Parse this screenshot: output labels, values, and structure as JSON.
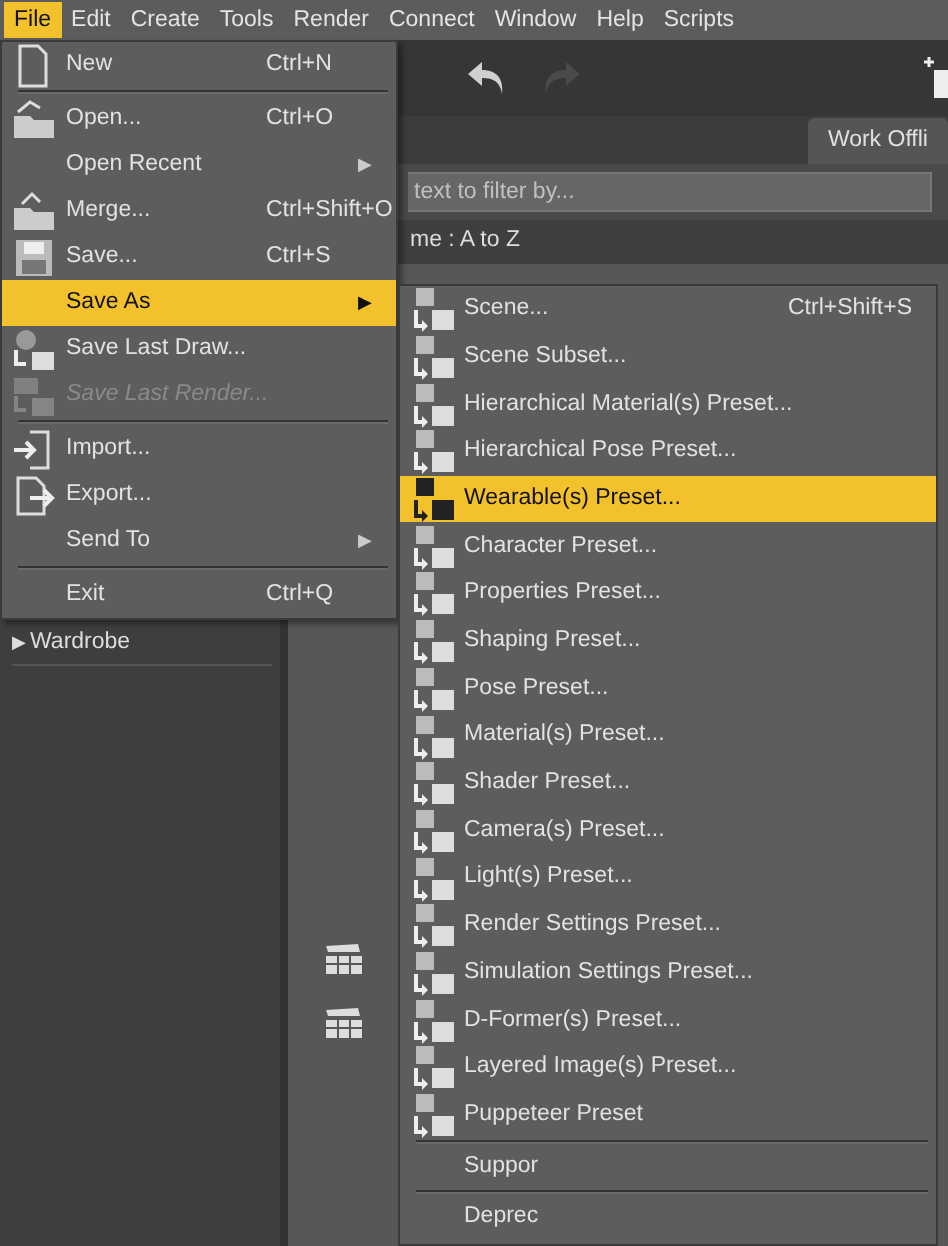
{
  "menubar": [
    {
      "label": "File",
      "selected": true
    },
    {
      "label": "Edit",
      "selected": false
    },
    {
      "label": "Create",
      "selected": false
    },
    {
      "label": "Tools",
      "selected": false
    },
    {
      "label": "Render",
      "selected": false
    },
    {
      "label": "Connect",
      "selected": false
    },
    {
      "label": "Window",
      "selected": false
    },
    {
      "label": "Help",
      "selected": false
    },
    {
      "label": "Scripts",
      "selected": false
    }
  ],
  "background": {
    "tab": "Work Offli",
    "filter_placeholder": "text to filter by...",
    "sort_label": "me : A to Z",
    "tree_items": [
      {
        "label": "Wardrobe",
        "arrow": "▶"
      }
    ]
  },
  "file_menu": [
    {
      "kind": "icon_item",
      "label": "New",
      "shortcut": "Ctrl+N",
      "selected": false,
      "disabled": false
    },
    {
      "kind": "separator"
    },
    {
      "kind": "icon_item",
      "label": "Open...",
      "shortcut": "Ctrl+O",
      "selected": false,
      "disabled": false
    },
    {
      "kind": "item",
      "label": "Open Recent",
      "arrow": "▶",
      "selected": false,
      "disabled": false
    },
    {
      "kind": "icon_item",
      "label": "Merge...",
      "shortcut": "Ctrl+Shift+O",
      "selected": false,
      "disabled": false
    },
    {
      "kind": "icon_item",
      "label": "Save...",
      "shortcut": "Ctrl+S",
      "selected": false,
      "disabled": false
    },
    {
      "kind": "item",
      "label": "Save As",
      "arrow": "▶",
      "selected": true,
      "disabled": false
    },
    {
      "kind": "icon_item",
      "label": "Save Last Draw...",
      "selected": false,
      "disabled": false
    },
    {
      "kind": "icon_item",
      "label": "Save Last Render...",
      "selected": false,
      "disabled": true
    },
    {
      "kind": "separator"
    },
    {
      "kind": "icon_item",
      "label": "Import...",
      "selected": false,
      "disabled": false
    },
    {
      "kind": "icon_item",
      "label": "Export...",
      "selected": false,
      "disabled": false
    },
    {
      "kind": "item",
      "label": "Send To",
      "arrow": "▶",
      "selected": false,
      "disabled": false
    },
    {
      "kind": "separator"
    },
    {
      "kind": "item",
      "label": "Exit",
      "shortcut": "Ctrl+Q",
      "selected": false,
      "disabled": false
    }
  ],
  "save_as_menu": [
    {
      "kind": "icon_item",
      "label": "Scene...",
      "shortcut": "Ctrl+Shift+S",
      "selected": false
    },
    {
      "kind": "icon_item",
      "label": "Scene Subset...",
      "selected": false
    },
    {
      "kind": "icon_item",
      "label": "Hierarchical Material(s) Preset...",
      "selected": false
    },
    {
      "kind": "icon_item",
      "label": "Hierarchical Pose Preset...",
      "selected": false
    },
    {
      "kind": "icon_item",
      "label": "Wearable(s) Preset...",
      "selected": true
    },
    {
      "kind": "icon_item",
      "label": "Character Preset...",
      "selected": false
    },
    {
      "kind": "icon_item",
      "label": "Properties Preset...",
      "selected": false
    },
    {
      "kind": "icon_item",
      "label": "Shaping Preset...",
      "selected": false
    },
    {
      "kind": "icon_item",
      "label": "Pose Preset...",
      "selected": false
    },
    {
      "kind": "icon_item",
      "label": "Material(s) Preset...",
      "selected": false
    },
    {
      "kind": "icon_item",
      "label": "Shader Preset...",
      "selected": false
    },
    {
      "kind": "icon_item",
      "label": "Camera(s) Preset...",
      "selected": false
    },
    {
      "kind": "icon_item",
      "label": "Light(s) Preset...",
      "selected": false
    },
    {
      "kind": "icon_item",
      "label": "Render Settings Preset...",
      "selected": false
    },
    {
      "kind": "icon_item",
      "label": "Simulation Settings Preset...",
      "selected": false
    },
    {
      "kind": "icon_item",
      "label": "D-Former(s) Preset...",
      "selected": false
    },
    {
      "kind": "icon_item",
      "label": "Layered Image(s) Preset...",
      "selected": false
    },
    {
      "kind": "icon_item",
      "label": "Puppeteer Preset",
      "selected": false
    },
    {
      "kind": "separator"
    },
    {
      "kind": "item",
      "label": "Suppor",
      "selected": false
    },
    {
      "kind": "separator"
    },
    {
      "kind": "item",
      "label": "Deprec",
      "selected": false
    }
  ]
}
